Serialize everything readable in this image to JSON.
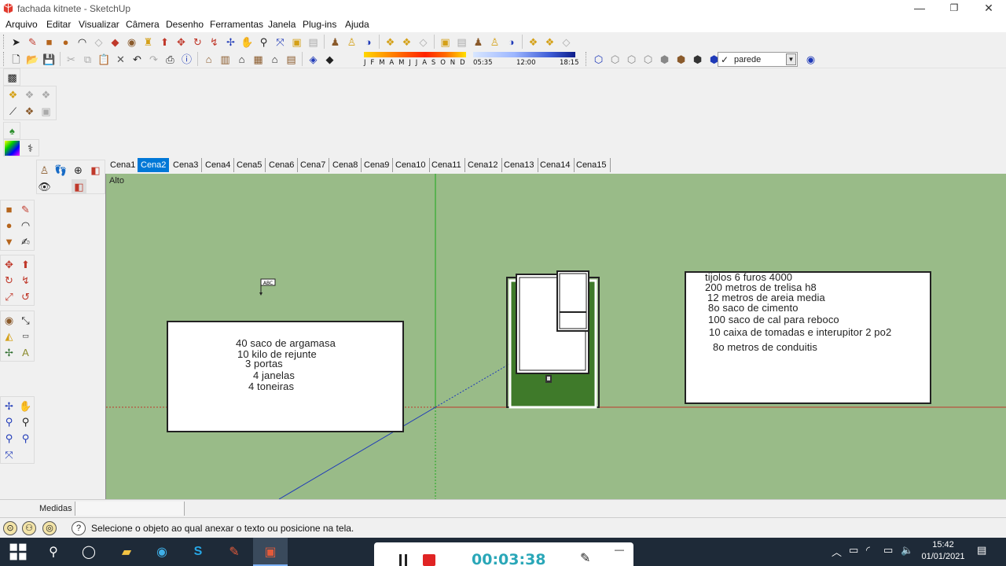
{
  "window": {
    "title": "fachada kitnete - SketchUp",
    "minimize": "—",
    "maximize": "❐",
    "close": "✕"
  },
  "menu": [
    "Arquivo",
    "Editar",
    "Visualizar",
    "Câmera",
    "Desenho",
    "Ferramentas",
    "Janela",
    "Plug-ins",
    "Ajuda"
  ],
  "shadow": {
    "months": "J F M A M J J A S O N D",
    "time_start": "05:35",
    "time_mid": "12:00",
    "time_end": "18:15"
  },
  "layer": {
    "selected": "parede"
  },
  "scenes": {
    "tabs": [
      "Cena1",
      "Cena2",
      "Cena3",
      "Cena4",
      "Cena5",
      "Cena6",
      "Cena7",
      "Cena8",
      "Cena9",
      "Cena10",
      "Cena11",
      "Cena12",
      "Cena13",
      "Cena14",
      "Cena15"
    ],
    "active_index": 1
  },
  "viewport": {
    "view_name": "Alto",
    "text_cursor_label": "ABC",
    "left_note": [
      "40 saco de argamasa",
      "10 kilo de rejunte",
      "3 portas",
      "4 janelas",
      "4 toneiras"
    ],
    "right_note": [
      "tijolos 6 furos 4000",
      "200 metros de trelisa h8",
      "12 metros de areia media",
      "8o saco de cimento",
      "100 saco de cal para reboco",
      "10 caixa de tomadas e interupitor 2 po2",
      "8o metros de conduitis"
    ]
  },
  "measurements": {
    "label": "Medidas",
    "value": ""
  },
  "status": {
    "help_icon": "?",
    "message": "Selecione o objeto ao qual anexar o texto ou posicione na tela."
  },
  "recorder": {
    "elapsed": "00:03:38",
    "minimize": "—"
  },
  "clock": {
    "time": "15:42",
    "date": "01/01/2021"
  },
  "colors": {
    "viewport_bg": "#99bb88",
    "axis_green": "#1aa81a",
    "axis_red": "#c0392b",
    "axis_blue": "#1f3ab8",
    "active_tab": "#0078d7",
    "taskbar": "#1e2a38",
    "grass": "#3f7a2a"
  }
}
